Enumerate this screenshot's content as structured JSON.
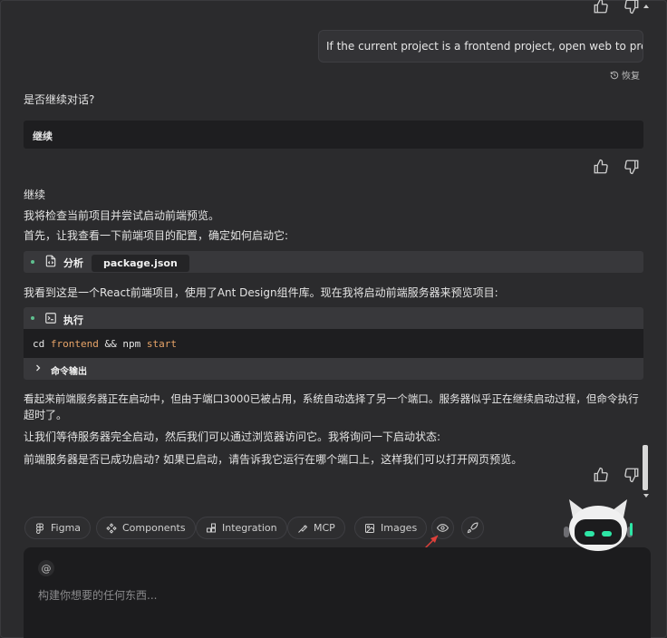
{
  "history": {
    "user_message": "If the current project is a frontend project, open web to preview it.",
    "restore_label": "恢复",
    "question": "是否继续对话?",
    "continue_box": "继续"
  },
  "assistant": {
    "line1": "继续",
    "line2": "我将检查当前项目并尝试启动前端预览。",
    "line3": "首先，让我查看一下前端项目的配置，确定如何启动它:",
    "analyze_label": "分析",
    "analyze_file": "package.json",
    "line4": "我看到这是一个React前端项目，使用了Ant Design组件库。现在我将启动前端服务器来预览项目:",
    "exec_label": "执行",
    "command": {
      "cd": "cd",
      "dir": "frontend",
      "and": "&&",
      "npm": "npm",
      "start": "start"
    },
    "output_label": "命令输出",
    "para1_line1": "看起来前端服务器正在启动中，但由于端口3000已被占用，系统自动选择了另一个端口。服务器似乎正在继续启动过程，但命令执行",
    "para1_line2": "超时了。",
    "para2": "让我们等待服务器完全启动，然后我们可以通过浏览器访问它。我将询问一下启动状态:",
    "para3": "前端服务器是否已成功启动? 如果已启动，请告诉我它运行在哪个端口上，这样我们可以打开网页预览。"
  },
  "toolbar": {
    "chips": [
      {
        "label": "Figma",
        "icon": "figma-icon"
      },
      {
        "label": "Components",
        "icon": "components-icon"
      },
      {
        "label": "Integration",
        "icon": "integration-icon"
      },
      {
        "label": "MCP",
        "icon": "mcp-icon"
      },
      {
        "label": "Images",
        "icon": "image-icon"
      }
    ],
    "preview_icon": "eye-icon",
    "deploy_icon": "rocket-icon"
  },
  "input": {
    "at_symbol": "@",
    "placeholder": "构建你想要的任何东西..."
  },
  "colors": {
    "background": "#2b2b2d",
    "accent_green": "#5fbf8f",
    "keyword_orange": "#e8a468",
    "annotation_arrow": "#e0403a",
    "mascot_eyes": "#2ee6a6"
  }
}
